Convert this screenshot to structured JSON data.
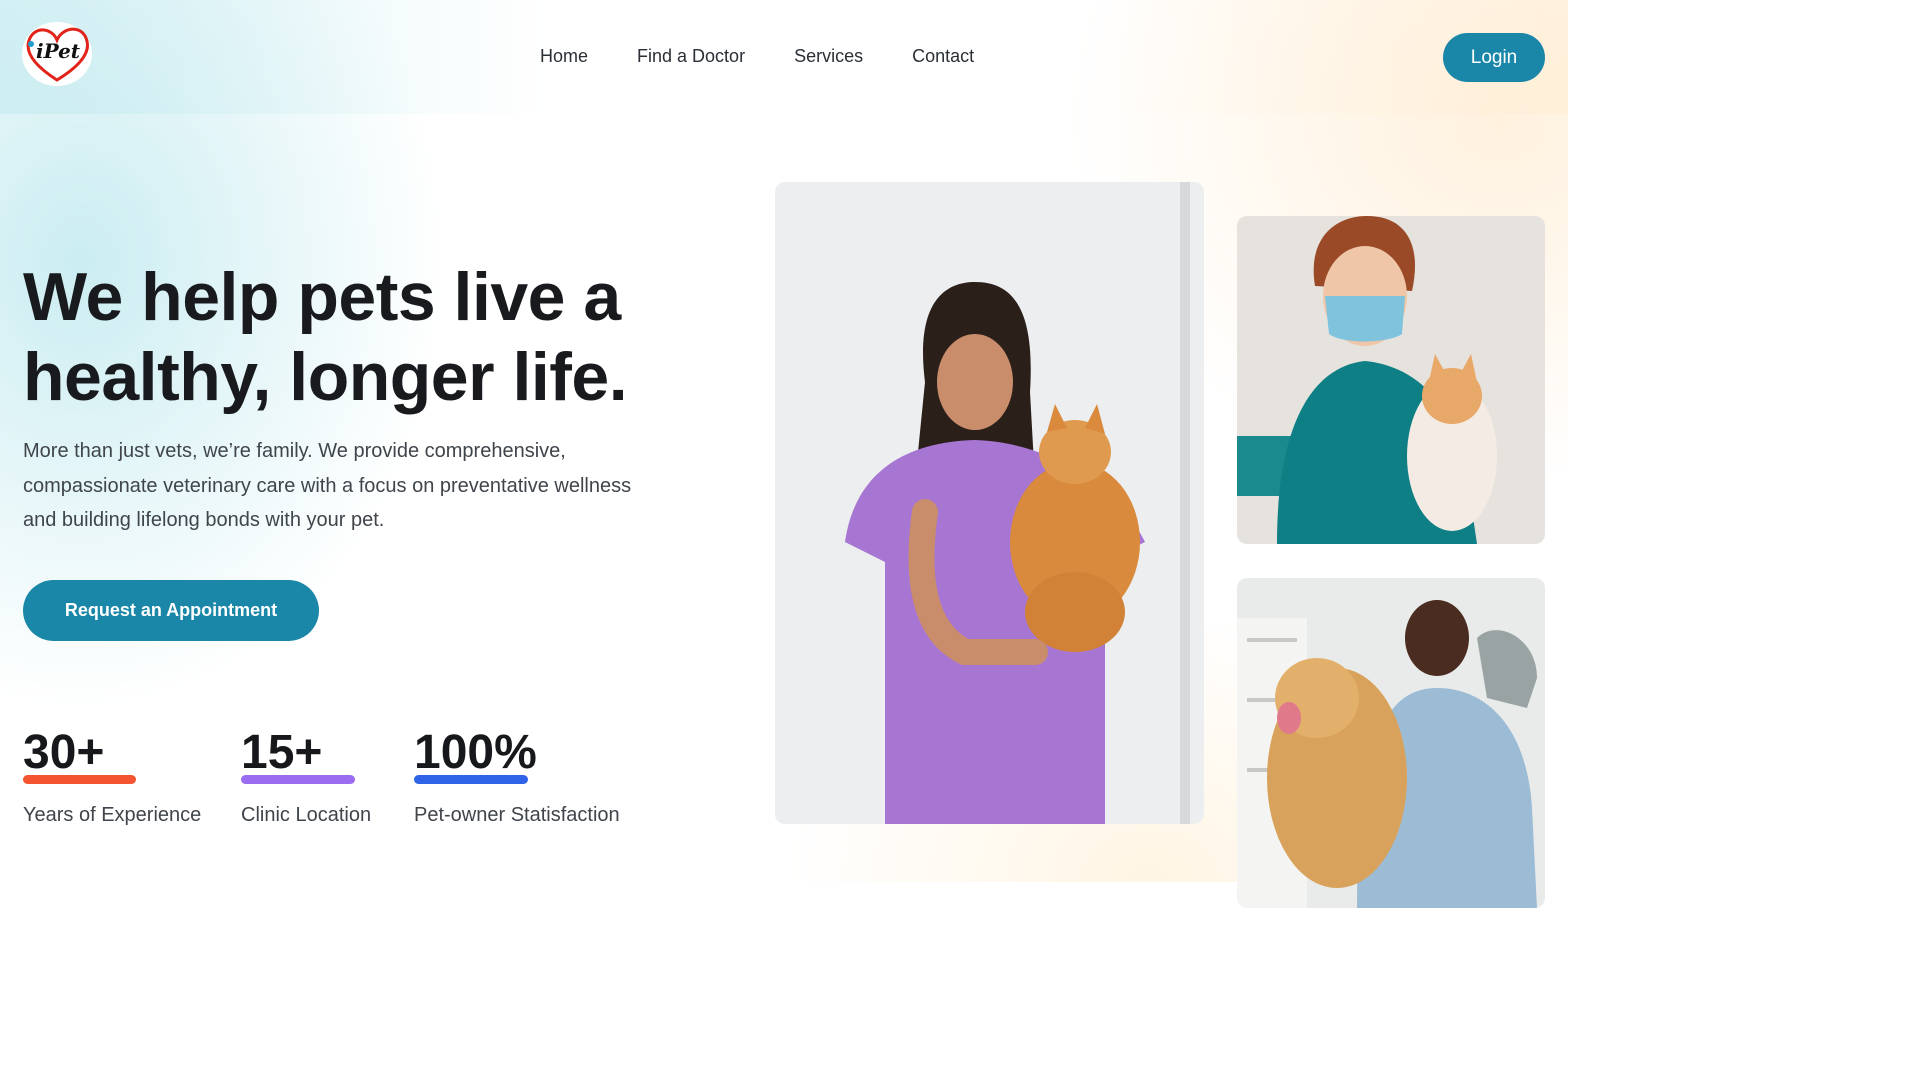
{
  "header": {
    "logo_text": "iPet",
    "nav": [
      "Home",
      "Find a Doctor",
      "Services",
      "Contact"
    ],
    "login_label": "Login"
  },
  "hero": {
    "headline_line1": "We help pets live a",
    "headline_line2": "healthy, longer life.",
    "subtext_line1": "More than just vets, we’re family. We provide comprehensive,",
    "subtext_line2": "compassionate veterinary care with a focus on preventative wellness",
    "subtext_line3": "and building lifelong bonds with your pet.",
    "cta_label": "Request an Appointment"
  },
  "stats": [
    {
      "value": "30+",
      "label": "Years of Experience",
      "accent": "#f4542f"
    },
    {
      "value": "15+",
      "label": "Clinic Location",
      "accent": "#9a6cf0"
    },
    {
      "value": "100%",
      "label": "Pet-owner Statisfaction",
      "accent": "#2f64e8"
    }
  ],
  "images": [
    {
      "name": "vet-woman-with-cat-photo"
    },
    {
      "name": "masked-vet-with-cat-photo"
    },
    {
      "name": "vet-man-with-dog-photo"
    }
  ],
  "colors": {
    "primary": "#1a87a8",
    "text": "#181a1d"
  }
}
